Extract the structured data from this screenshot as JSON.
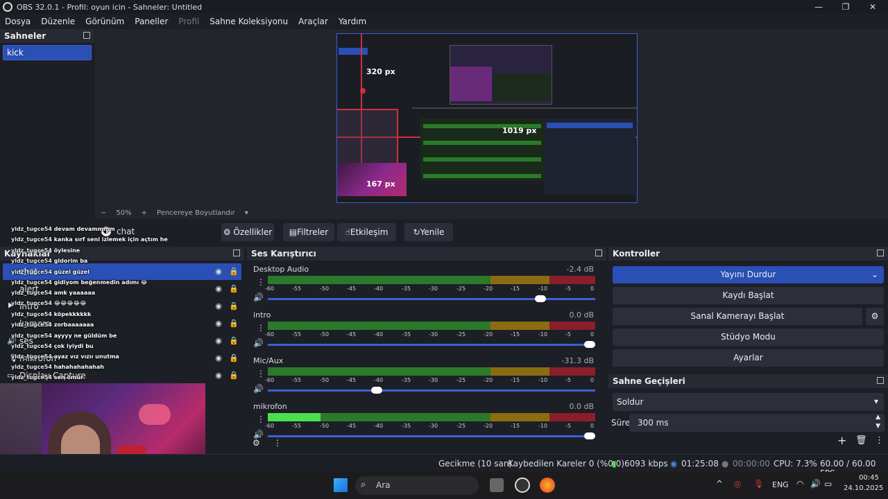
{
  "window": {
    "title": "OBS 32.0.1 - Profil: oyun icin - Sahneler: Untitled"
  },
  "menu": {
    "items": [
      "Dosya",
      "Düzenle",
      "Görünüm",
      "Paneller",
      "Profil",
      "Sahne Koleksiyonu",
      "Araçlar",
      "Yardım"
    ]
  },
  "scenes": {
    "header": "Sahneler",
    "items": [
      "kick"
    ]
  },
  "preview": {
    "zoom": "50%",
    "fit_label": "Pencereye Boyutlandır",
    "top_dim": "320 px",
    "right_dim": "1019 px",
    "bottom_dim": "167 px"
  },
  "toolbar": {
    "source_name": "chat",
    "properties": "Özellikler",
    "filters": "Filtreler",
    "interact": "Etkileşim",
    "refresh": "Yenile"
  },
  "sources": {
    "header": "Kaynaklar",
    "items": [
      {
        "name": "chat",
        "selected": true
      },
      {
        "name": "alert",
        "selected": false
      },
      {
        "name": "intro",
        "selected": false
      },
      {
        "name": "kamera",
        "selected": false
      },
      {
        "name": "ses",
        "selected": false
      },
      {
        "name": "mikrofon",
        "selected": false
      },
      {
        "name": "Display Capture",
        "selected": false
      }
    ]
  },
  "chat": {
    "messages": [
      {
        "user": "yldz_tugce54",
        "text": "devam devammmm"
      },
      {
        "user": "yldz_tugce54",
        "text": "kanka sırf seni izlemek için açtım he"
      },
      {
        "user": "yldz_tugce54",
        "text": "öylesine"
      },
      {
        "user": "yldz_tugce54",
        "text": "gldorim ba"
      },
      {
        "user": "yldz_tugce54",
        "text": "güzel güzel"
      },
      {
        "user": "yldz_tugce54",
        "text": "gidiyom beğenmedin adımı 😂"
      },
      {
        "user": "yldz_tugce54",
        "text": "amk yaaaaaa"
      },
      {
        "user": "yldz_tugce54",
        "text": "😂😂😂😂😂"
      },
      {
        "user": "yldz_tugce54",
        "text": "köpekkkkkk"
      },
      {
        "user": "yldz_tugce54",
        "text": "zorbaaaaaaa"
      },
      {
        "user": "yldz_tugce54",
        "text": "ayyyy ne güldüm be"
      },
      {
        "user": "yldz_tugce54",
        "text": "çok iyiydi bu"
      },
      {
        "user": "yldz_tugce54",
        "text": "ayaz vız vızıı unutma"
      },
      {
        "user": "yldz_tugce54",
        "text": "hahahahahahah"
      },
      {
        "user": "yldz_tugce54",
        "text": "sen ömür"
      }
    ]
  },
  "mixer": {
    "header": "Ses Karıştırıcı",
    "ticks": [
      "-60",
      "-55",
      "-50",
      "-45",
      "-40",
      "-35",
      "-30",
      "-25",
      "-20",
      "-15",
      "-10",
      "-5",
      "0"
    ],
    "channels": [
      {
        "name": "Desktop Audio",
        "db": "-2.4 dB",
        "level": 0.0,
        "volume": 0.85
      },
      {
        "name": "intro",
        "db": "0.0 dB",
        "level": 0.0,
        "volume": 1.0
      },
      {
        "name": "Mic/Aux",
        "db": "-31.3 dB",
        "level": 0.0,
        "volume": 0.35
      },
      {
        "name": "mikrofon",
        "db": "0.0 dB",
        "level": 0.16,
        "volume": 1.0
      }
    ]
  },
  "controls": {
    "header": "Kontroller",
    "stop_stream": "Yayını Durdur",
    "start_record": "Kaydı Başlat",
    "virtual_cam": "Sanal Kamerayı Başlat",
    "studio_mode": "Stüdyo Modu",
    "settings": "Ayarlar"
  },
  "transitions": {
    "header": "Sahne Geçişleri",
    "selected": "Soldur",
    "duration_label": "Süre",
    "duration_value": "300 ms"
  },
  "status": {
    "delay": "Gecikme (10 san)",
    "dropped": "Kaybedilen Kareler 0 (%0.0)",
    "bitrate": "6093 kbps",
    "stream_time": "01:25:08",
    "record_time": "00:00:00",
    "cpu": "CPU: 7.3%",
    "fps": "60.00 / 60.00 FPS"
  },
  "taskbar": {
    "search": "Ara",
    "lang": "ENG",
    "time": "00:45",
    "date": "24.10.2025"
  }
}
